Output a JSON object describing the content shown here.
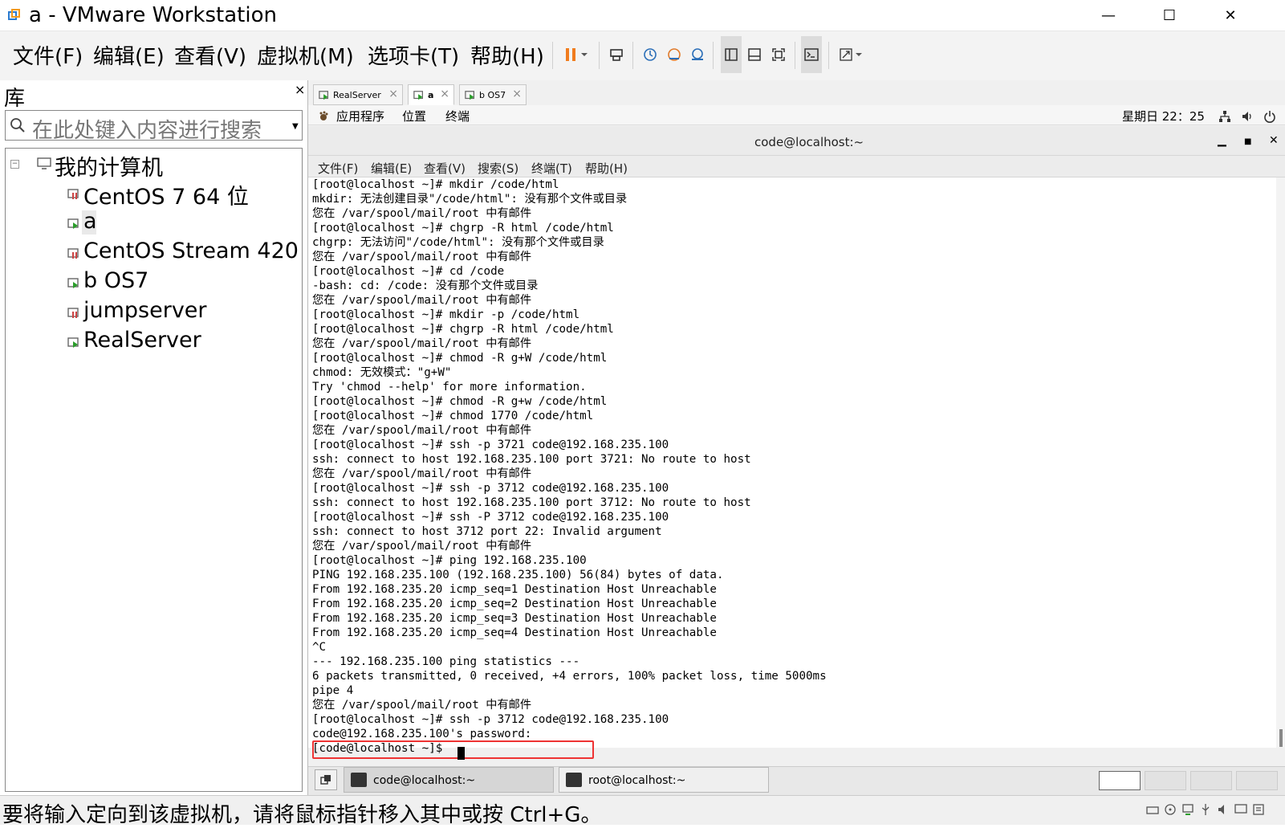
{
  "window": {
    "title": "a - VMware Workstation",
    "minimize": "—",
    "maximize": "☐",
    "close": "✕"
  },
  "menu": [
    "文件(F)",
    "编辑(E)",
    "查看(V)",
    "虚拟机(M)",
    "选项卡(T)",
    "帮助(H)"
  ],
  "library": {
    "title": "库",
    "close": "×",
    "search_placeholder": "在此处键入内容进行搜索",
    "root_label": "我的计算机",
    "items": [
      "CentOS 7 64 位",
      "a",
      "CentOS Stream 420",
      "b OS7",
      "jumpserver",
      "RealServer"
    ]
  },
  "vm_tabs": [
    {
      "label": "RealServer",
      "active": false
    },
    {
      "label": "a",
      "active": true
    },
    {
      "label": "b OS7",
      "active": false
    }
  ],
  "guest_panel": {
    "menus": [
      "应用程序",
      "位置",
      "终端"
    ],
    "clock": "星期日 22：25"
  },
  "terminal": {
    "title": "code@localhost:~",
    "menus": [
      "文件(F)",
      "编辑(E)",
      "查看(V)",
      "搜索(S)",
      "终端(T)",
      "帮助(H)"
    ],
    "lines": [
      "[root@localhost ~]# mkdir /code/html",
      "mkdir: 无法创建目录\"/code/html\": 没有那个文件或目录",
      "您在 /var/spool/mail/root 中有邮件",
      "[root@localhost ~]# chgrp -R html /code/html",
      "chgrp: 无法访问\"/code/html\": 没有那个文件或目录",
      "您在 /var/spool/mail/root 中有邮件",
      "[root@localhost ~]# cd /code",
      "-bash: cd: /code: 没有那个文件或目录",
      "您在 /var/spool/mail/root 中有邮件",
      "[root@localhost ~]# mkdir -p /code/html",
      "[root@localhost ~]# chgrp -R html /code/html",
      "您在 /var/spool/mail/root 中有邮件",
      "[root@localhost ~]# chmod -R g+W /code/html",
      "chmod: 无效模式：\"g+W\"",
      "Try 'chmod --help' for more information.",
      "[root@localhost ~]# chmod -R g+w /code/html",
      "[root@localhost ~]# chmod 1770 /code/html",
      "您在 /var/spool/mail/root 中有邮件",
      "[root@localhost ~]# ssh -p 3721 code@192.168.235.100",
      "ssh: connect to host 192.168.235.100 port 3721: No route to host",
      "您在 /var/spool/mail/root 中有邮件",
      "[root@localhost ~]# ssh -p 3712 code@192.168.235.100",
      "ssh: connect to host 192.168.235.100 port 3712: No route to host",
      "[root@localhost ~]# ssh -P 3712 code@192.168.235.100",
      "ssh: connect to host 3712 port 22: Invalid argument",
      "您在 /var/spool/mail/root 中有邮件",
      "[root@localhost ~]# ping 192.168.235.100",
      "PING 192.168.235.100 (192.168.235.100) 56(84) bytes of data.",
      "From 192.168.235.20 icmp_seq=1 Destination Host Unreachable",
      "From 192.168.235.20 icmp_seq=2 Destination Host Unreachable",
      "From 192.168.235.20 icmp_seq=3 Destination Host Unreachable",
      "From 192.168.235.20 icmp_seq=4 Destination Host Unreachable",
      "^C",
      "--- 192.168.235.100 ping statistics ---",
      "6 packets transmitted, 0 received, +4 errors, 100% packet loss, time 5000ms",
      "pipe 4",
      "您在 /var/spool/mail/root 中有邮件",
      "[root@localhost ~]# ssh -p 3712 code@192.168.235.100",
      "code@192.168.235.100's password:",
      "[code@localhost ~]$ "
    ]
  },
  "taskbar": {
    "items": [
      {
        "label": "code@localhost:~",
        "active": true
      },
      {
        "label": "root@localhost:~",
        "active": false
      }
    ]
  },
  "statusbar": {
    "text": "要将输入定向到该虚拟机，请将鼠标指针移入其中或按 Ctrl+G。"
  },
  "colors": {
    "pause_accent": "#f07c1e",
    "highlight_box": "#e33333"
  }
}
